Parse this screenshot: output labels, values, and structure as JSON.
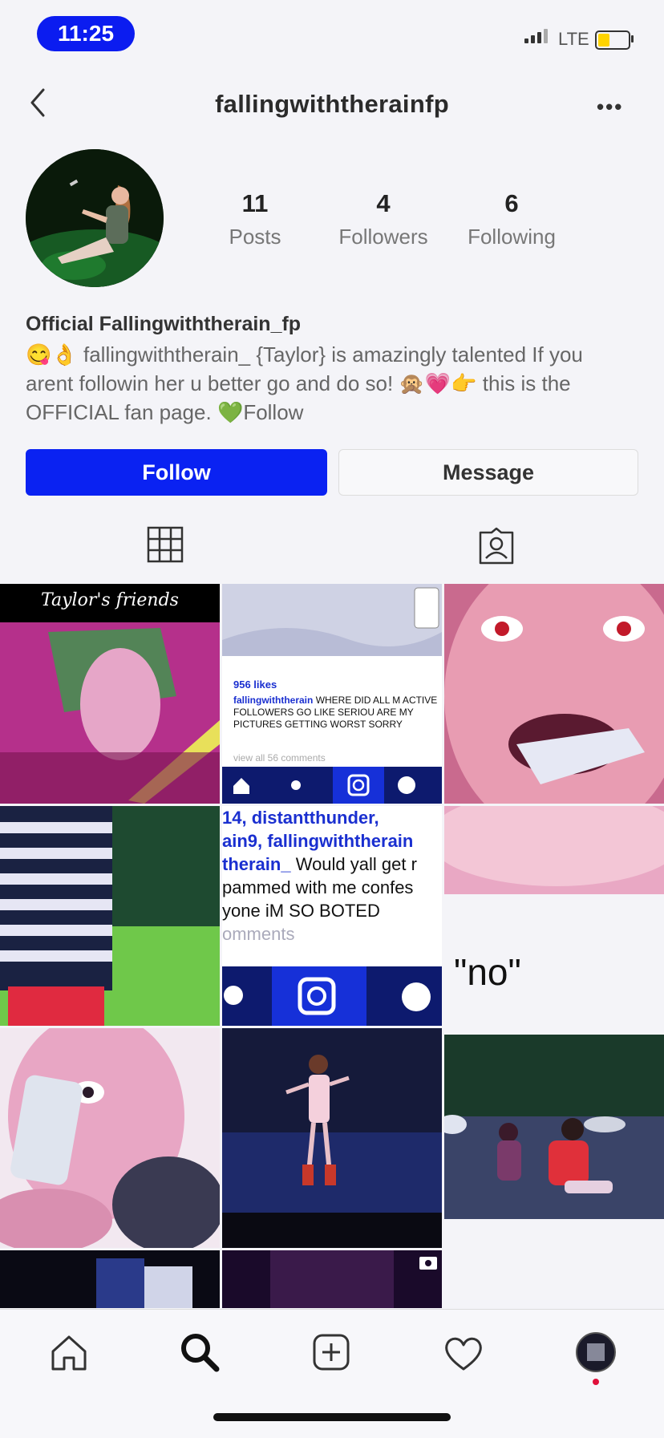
{
  "status_bar": {
    "time": "11:25",
    "network": "LTE"
  },
  "header": {
    "username": "fallingwiththerainfp",
    "more": "•••"
  },
  "stats": [
    {
      "number": "11",
      "label": "Posts"
    },
    {
      "number": "4",
      "label": "Followers"
    },
    {
      "number": "6",
      "label": "Following"
    }
  ],
  "profile": {
    "display_name": "Official Fallingwiththerain_fp",
    "bio_emoji_1": "😋👌",
    "bio_text_1": "fallingwiththerain_ {Taylor} is amazingly talented If you arent followin her u better go and do so!",
    "bio_emoji_2": "🙊💗👉",
    "bio_text_2": "this is the OFFICIAL fan page.",
    "bio_emoji_3": "💚",
    "bio_text_3": "Follow"
  },
  "buttons": {
    "follow": "Follow",
    "message": "Message"
  },
  "posts": {
    "p1_caption": "Taylor's friends",
    "p2_likes": "956 likes",
    "p2_user": "fallingwiththerain",
    "p2_caption": "WHERE DID ALL M ACTIVE FOLLOWERS GO LIKE SERIOU ARE MY PICTURES GETTING WORST SORRY",
    "p2_comments": "view all 56 comments",
    "p5_line1": "14, distantthunder,",
    "p5_line2": "ain9, fallingwiththerain",
    "p5_line3_user": "therain_",
    "p5_line3_text": " Would yall get r",
    "p5_line4": "pammed with me confes",
    "p5_line5": "yone iM SO BOTED",
    "p5_comments": "omments",
    "p6_text": "\"no\""
  },
  "colors": {
    "accent": "#0a22f2",
    "time_pill": "#0b1cf0"
  },
  "tab_bar": [
    "home-icon",
    "search-icon",
    "add-post-icon",
    "heart-icon",
    "profile-avatar"
  ]
}
